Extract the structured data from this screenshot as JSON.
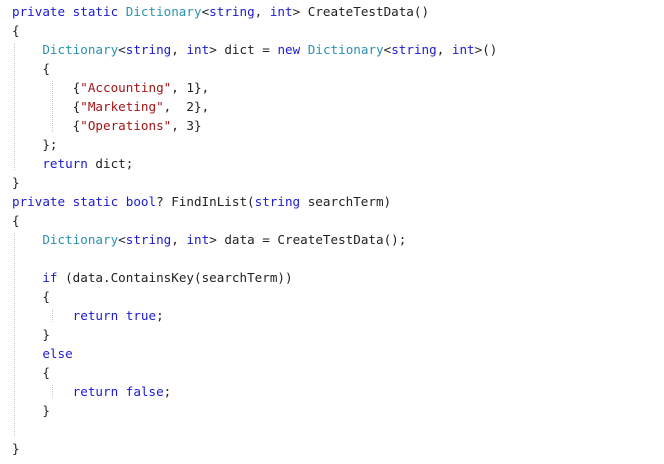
{
  "editor": {
    "lines": [
      [
        {
          "t": "private static ",
          "c": "kw"
        },
        {
          "t": "Dictionary",
          "c": "ty"
        },
        {
          "t": "<",
          "c": "pl"
        },
        {
          "t": "string",
          "c": "kw"
        },
        {
          "t": ", ",
          "c": "pl"
        },
        {
          "t": "int",
          "c": "kw"
        },
        {
          "t": "> CreateTestData()",
          "c": "pl"
        }
      ],
      [
        {
          "t": "{",
          "c": "pl"
        }
      ],
      [
        {
          "t": "    ",
          "c": "pl"
        },
        {
          "t": "Dictionary",
          "c": "ty"
        },
        {
          "t": "<",
          "c": "pl"
        },
        {
          "t": "string",
          "c": "kw"
        },
        {
          "t": ", ",
          "c": "pl"
        },
        {
          "t": "int",
          "c": "kw"
        },
        {
          "t": "> dict = ",
          "c": "pl"
        },
        {
          "t": "new ",
          "c": "kw"
        },
        {
          "t": "Dictionary",
          "c": "ty"
        },
        {
          "t": "<",
          "c": "pl"
        },
        {
          "t": "string",
          "c": "kw"
        },
        {
          "t": ", ",
          "c": "pl"
        },
        {
          "t": "int",
          "c": "kw"
        },
        {
          "t": ">()",
          "c": "pl"
        }
      ],
      [
        {
          "t": "    {",
          "c": "pl"
        }
      ],
      [
        {
          "t": "        {",
          "c": "pl"
        },
        {
          "t": "\"Accounting\"",
          "c": "str"
        },
        {
          "t": ", 1},",
          "c": "pl"
        }
      ],
      [
        {
          "t": "        {",
          "c": "pl"
        },
        {
          "t": "\"Marketing\"",
          "c": "str"
        },
        {
          "t": ",  2},",
          "c": "pl"
        }
      ],
      [
        {
          "t": "        {",
          "c": "pl"
        },
        {
          "t": "\"Operations\"",
          "c": "str"
        },
        {
          "t": ", 3}",
          "c": "pl"
        }
      ],
      [
        {
          "t": "    };",
          "c": "pl"
        }
      ],
      [
        {
          "t": "    ",
          "c": "pl"
        },
        {
          "t": "return",
          "c": "kw"
        },
        {
          "t": " dict;",
          "c": "pl"
        }
      ],
      [
        {
          "t": "}",
          "c": "pl"
        }
      ],
      [
        {
          "t": "private static bool",
          "c": "kw"
        },
        {
          "t": "? FindInList(",
          "c": "pl"
        },
        {
          "t": "string",
          "c": "kw"
        },
        {
          "t": " searchTerm)",
          "c": "pl"
        }
      ],
      [
        {
          "t": "{",
          "c": "pl"
        }
      ],
      [
        {
          "t": "    ",
          "c": "pl"
        },
        {
          "t": "Dictionary",
          "c": "ty"
        },
        {
          "t": "<",
          "c": "pl"
        },
        {
          "t": "string",
          "c": "kw"
        },
        {
          "t": ", ",
          "c": "pl"
        },
        {
          "t": "int",
          "c": "kw"
        },
        {
          "t": "> data = CreateTestData();",
          "c": "pl"
        }
      ],
      [],
      [
        {
          "t": "    ",
          "c": "pl"
        },
        {
          "t": "if",
          "c": "kw"
        },
        {
          "t": " (data.ContainsKey(searchTerm))",
          "c": "pl"
        }
      ],
      [
        {
          "t": "    {",
          "c": "pl"
        }
      ],
      [
        {
          "t": "        ",
          "c": "pl"
        },
        {
          "t": "return true",
          "c": "kw"
        },
        {
          "t": ";",
          "c": "pl"
        }
      ],
      [
        {
          "t": "    }",
          "c": "pl"
        }
      ],
      [
        {
          "t": "    ",
          "c": "pl"
        },
        {
          "t": "else",
          "c": "kw"
        }
      ],
      [
        {
          "t": "    {",
          "c": "pl"
        }
      ],
      [
        {
          "t": "        ",
          "c": "pl"
        },
        {
          "t": "return false",
          "c": "kw"
        },
        {
          "t": ";",
          "c": "pl"
        }
      ],
      [
        {
          "t": "    }",
          "c": "pl"
        }
      ],
      [],
      [
        {
          "t": "}",
          "c": "pl"
        }
      ]
    ]
  }
}
